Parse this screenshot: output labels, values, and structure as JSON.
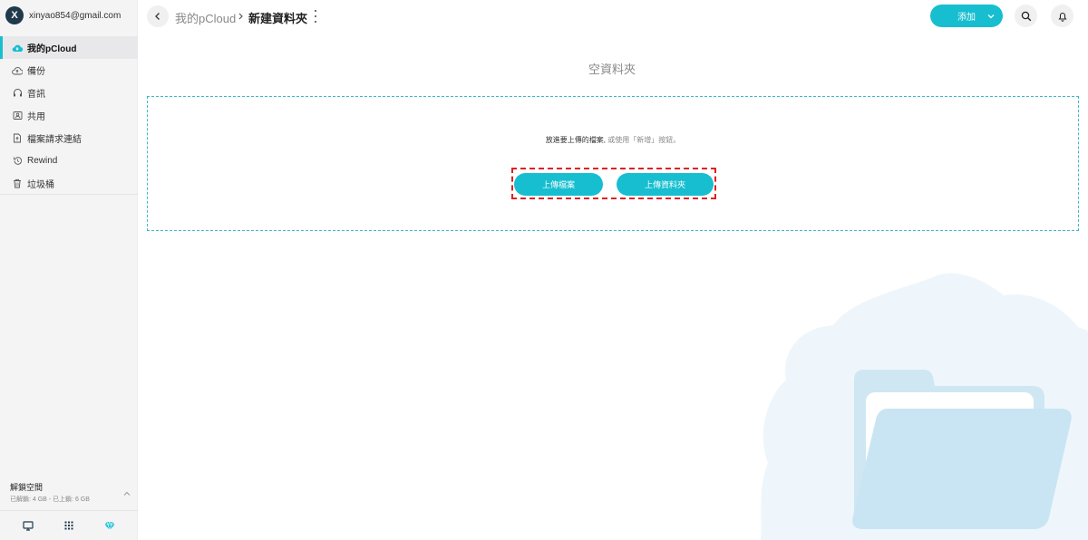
{
  "account": {
    "avatar_letter": "X",
    "email": "xinyao854@gmail.com"
  },
  "sidebar": {
    "items": [
      {
        "label": "我的pCloud",
        "icon": "cloud-icon",
        "active": true
      },
      {
        "label": "備份",
        "icon": "backup-icon",
        "active": false
      },
      {
        "label": "音訊",
        "icon": "headphones-icon",
        "active": false
      },
      {
        "label": "共用",
        "icon": "shared-icon",
        "active": false
      },
      {
        "label": "檔案請求連結",
        "icon": "file-request-icon",
        "active": false
      },
      {
        "label": "Rewind",
        "icon": "rewind-icon",
        "active": false
      },
      {
        "label": "垃圾桶",
        "icon": "trash-icon",
        "active": false
      }
    ],
    "unlock": {
      "title": "解鎖空間",
      "subtitle": "已解鎖: 4 GB - 已上鎖: 6 GB"
    },
    "bottom_icons": [
      "desktop-icon",
      "apps-grid-icon",
      "diamond-icon"
    ]
  },
  "header": {
    "breadcrumb_root": "我的pCloud",
    "breadcrumb_current": "新建資料夾",
    "add_label": "添加"
  },
  "main": {
    "empty_title": "空資料夾",
    "drop_text": "放進要上傳的檔案,",
    "drop_hint": "或使用「新增」按鈕。",
    "upload_file_label": "上傳檔案",
    "upload_folder_label": "上傳資料夾"
  },
  "colors": {
    "accent": "#17bed0",
    "sidebar_bg": "#f4f4f5",
    "highlight_border": "#e02020",
    "dropzone_border": "#3fb6c9"
  }
}
